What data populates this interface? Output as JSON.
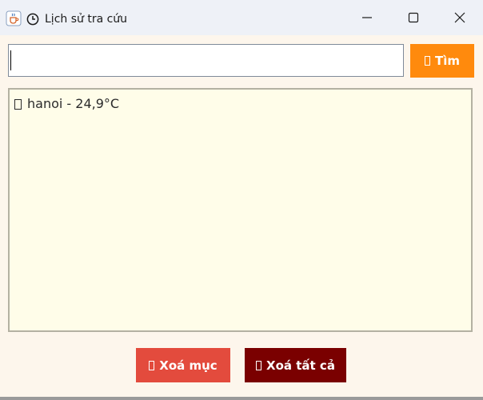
{
  "window": {
    "title": "Lịch sử tra cứu",
    "app_icon": "java-coffee-cup-icon",
    "title_icon": "clock-icon",
    "controls": [
      "minimize-icon",
      "maximize-icon",
      "close-icon"
    ]
  },
  "search": {
    "value": "",
    "button_label": "Tìm",
    "button_icon": "missing-glyph-box",
    "button_color": "#ff8a0d"
  },
  "history": {
    "background": "#fffde9",
    "items": [
      {
        "icon": "missing-glyph-box",
        "text": "hanoi - 24,9°C"
      }
    ]
  },
  "actions": {
    "delete_item_label": "Xoá mục",
    "delete_item_color": "#e34b3d",
    "delete_all_label": "Xoá tất cả",
    "delete_all_color": "#7a0000"
  }
}
